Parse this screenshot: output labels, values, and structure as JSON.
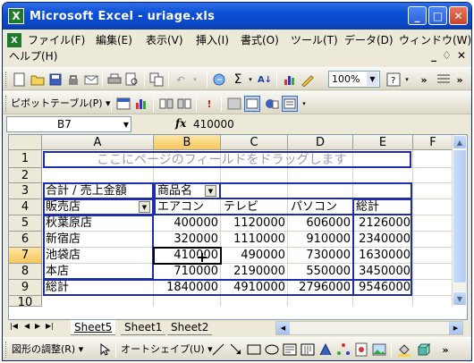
{
  "window": {
    "title": "Microsoft Excel - uriage.xls",
    "app_icon": "X"
  },
  "window_buttons": {
    "minimize": "_",
    "maximize": "□",
    "close": "✕"
  },
  "menubar": {
    "items": [
      "ファイル(F)",
      "編集(E)",
      "表示(V)",
      "挿入(I)",
      "書式(O)",
      "ツール(T)",
      "データ(D)",
      "ウィンドウ(W)",
      "ヘルプ(H)"
    ],
    "mdi_controls": [
      "_",
      "♢",
      "✕"
    ]
  },
  "toolbar1": {
    "zoom": "100%"
  },
  "toolbar2": {
    "pivot_label": "ピボットテーブル(P) ▾"
  },
  "formula": {
    "name_box": "B7",
    "fx": "fx",
    "value": "410000"
  },
  "columns": [
    "A",
    "B",
    "C",
    "D",
    "E",
    "F"
  ],
  "rows": [
    "1",
    "2",
    "3",
    "4",
    "5",
    "6",
    "7",
    "8",
    "9",
    "10"
  ],
  "pivot": {
    "drop_hint": "ここにページのフィールドをドラッグします",
    "data_label": "合計 / 売上金額",
    "column_field": "商品名",
    "row_field": "販売店",
    "column_items": [
      "エアコン",
      "テレビ",
      "パソコン",
      "総計"
    ],
    "rows": [
      {
        "label": "秋葉原店",
        "values": [
          "400000",
          "1120000",
          "606000",
          "2126000"
        ]
      },
      {
        "label": "新宿店",
        "values": [
          "320000",
          "1110000",
          "910000",
          "2340000"
        ]
      },
      {
        "label": "池袋店",
        "values": [
          "410000",
          "490000",
          "730000",
          "1630000"
        ]
      },
      {
        "label": "本店",
        "values": [
          "710000",
          "2190000",
          "550000",
          "3450000"
        ]
      },
      {
        "label": "総計",
        "values": [
          "1840000",
          "4910000",
          "2796000",
          "9546000"
        ]
      }
    ]
  },
  "sheets": {
    "tabs": [
      "Sheet5",
      "Sheet1",
      "Sheet2"
    ],
    "active": "Sheet5"
  },
  "drawbar": {
    "adjust_label": "図形の調整(R) ▾",
    "autoshape_label": "オートシェイプ(U) ▾"
  },
  "colors": {
    "title_bar": "#0b4fd4",
    "pivot_border": "#1f2ea8",
    "header_selected": "#f7c75c"
  }
}
